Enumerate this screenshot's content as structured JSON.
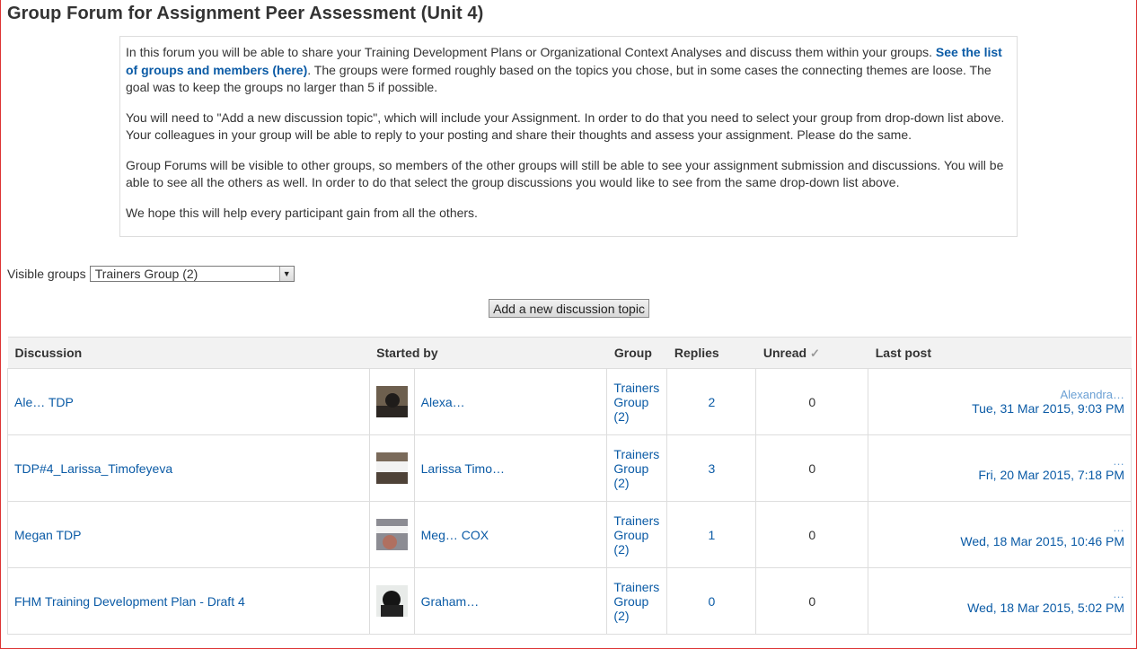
{
  "title": "Group Forum for Assignment Peer Assessment (Unit 4)",
  "intro": {
    "p1_a": "In this forum you will be able to share your Training Development Plans or Organizational Context Analyses and discuss them within your groups. ",
    "p1_link": "See the list of groups and members (here)",
    "p1_b": ". The groups were formed roughly based on the topics you chose, but in some cases the connecting themes are loose. The goal was to keep the groups no larger than 5 if possible.",
    "p2": "You will need to \"Add a new discussion topic\", which will include your Assignment. In order to do that you need to select your group from drop-down list above. Your colleagues in your group will be able to reply to your posting and share their thoughts and assess your assignment. Please do the same.",
    "p3": "Group Forums will be visible to other groups, so members of the other groups will still be able to see your assignment submission and discussions. You will be able to see all the others as well. In order to do that select the group discussions you would like to see from the same drop-down list above.",
    "p4": "We hope this will help every participant gain from all the others."
  },
  "groups": {
    "label": "Visible groups",
    "selected": "Trainers Group (2)"
  },
  "add_button": "Add a new discussion topic",
  "table": {
    "headers": {
      "discussion": "Discussion",
      "started_by": "Started by",
      "group": "Group",
      "replies": "Replies",
      "unread": "Unread",
      "last_post": "Last post"
    },
    "rows": [
      {
        "discussion": "Ale… TDP",
        "author": "Alexa…",
        "group": "Trainers Group (2)",
        "replies": "2",
        "unread": "0",
        "last_author": "Alexandra…",
        "last_date": "Tue, 31 Mar 2015, 9:03 PM"
      },
      {
        "discussion": "TDP#4_Larissa_Timofeyeva",
        "author": "Larissa Timo…",
        "group": "Trainers Group (2)",
        "replies": "3",
        "unread": "0",
        "last_author": "…",
        "last_date": "Fri, 20 Mar 2015, 7:18 PM"
      },
      {
        "discussion": "Megan TDP",
        "author": "Meg… COX",
        "group": "Trainers Group (2)",
        "replies": "1",
        "unread": "0",
        "last_author": "…",
        "last_date": "Wed, 18 Mar 2015, 10:46 PM"
      },
      {
        "discussion": "FHM Training Development Plan - Draft 4",
        "author": "Graham…",
        "group": "Trainers Group (2)",
        "replies": "0",
        "unread": "0",
        "last_author": "…",
        "last_date": "Wed, 18 Mar 2015, 5:02 PM"
      }
    ]
  }
}
